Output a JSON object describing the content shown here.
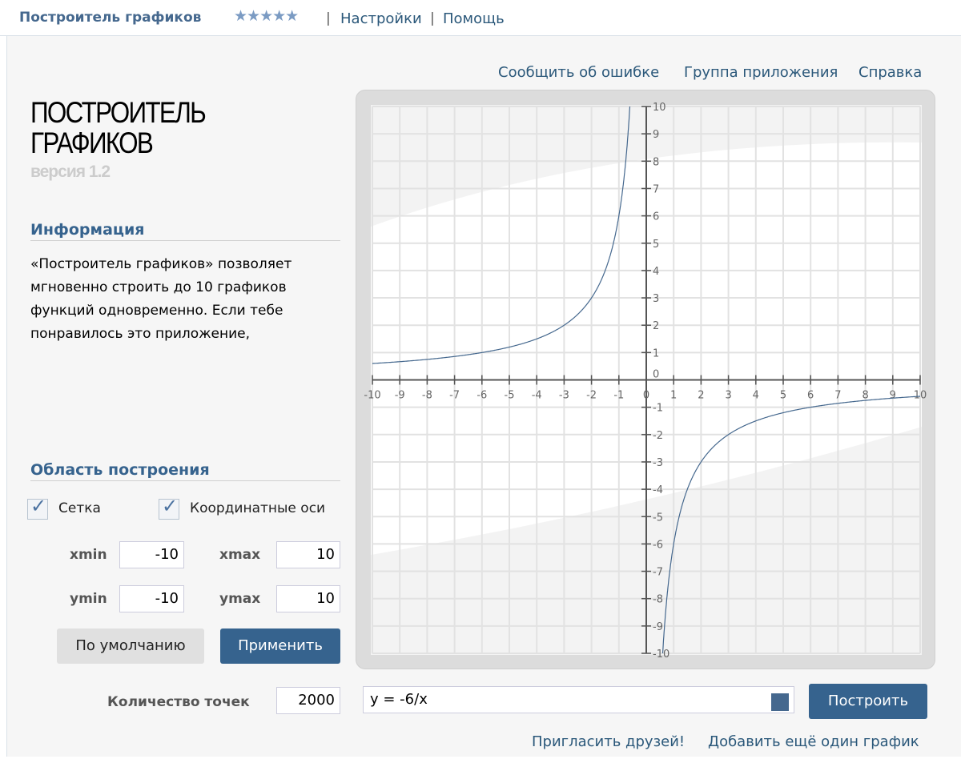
{
  "topbar": {
    "title": "Построитель графиков",
    "stars": "★★★★★",
    "rating": 5,
    "settings": "Настройки",
    "help": "Помощь",
    "sep": "|"
  },
  "header_links": {
    "report": "Сообщить об ошибке",
    "group": "Группа приложения",
    "reference": "Справка"
  },
  "logo": {
    "line1": "ПОСТРОИТЕЛЬ",
    "line2": "ГРАФИКОВ",
    "version": "версия 1.2"
  },
  "info": {
    "title": "Информация",
    "text": "«Построитель графиков» позволяет мгновенно строить до 10 графиков функций одновременно. Если тебе понравилось это приложение,"
  },
  "area": {
    "title": "Область построения",
    "grid_label": "Сетка",
    "grid_checked": true,
    "axes_label": "Координатные оси",
    "axes_checked": true,
    "xmin_label": "xmin",
    "xmin": "-10",
    "xmax_label": "xmax",
    "xmax": "10",
    "ymin_label": "ymin",
    "ymin": "-10",
    "ymax_label": "ymax",
    "ymax": "10",
    "default_button": "По умолчанию",
    "apply_button": "Применить"
  },
  "bottom": {
    "points_label": "Количество точек",
    "points": "2000",
    "function": "y = -6/x",
    "color": "#45688e",
    "plot_button": "Построить",
    "invite": "Пригласить друзей!",
    "add_graph": "Добавить ещё один график"
  },
  "chart_data": {
    "type": "line",
    "function": "y = -6/x",
    "xlim": [
      -10,
      10
    ],
    "ylim": [
      -10,
      10
    ],
    "grid": true,
    "axes": true,
    "x_ticks": [
      "-10",
      "-9",
      "-8",
      "-7",
      "-6",
      "-5",
      "-4",
      "-3",
      "-2",
      "-1",
      "0",
      "1",
      "2",
      "3",
      "4",
      "5",
      "6",
      "7",
      "8",
      "9",
      "10"
    ],
    "y_ticks": [
      "-10",
      "-9",
      "-8",
      "-7",
      "-6",
      "-5",
      "-4",
      "-3",
      "-2",
      "-1",
      "1",
      "2",
      "3",
      "4",
      "5",
      "6",
      "7",
      "8",
      "9",
      "10"
    ],
    "origin_label": "0",
    "series": [
      {
        "name": "y = -6/x",
        "coef": -6,
        "color": "#45688e"
      }
    ]
  }
}
